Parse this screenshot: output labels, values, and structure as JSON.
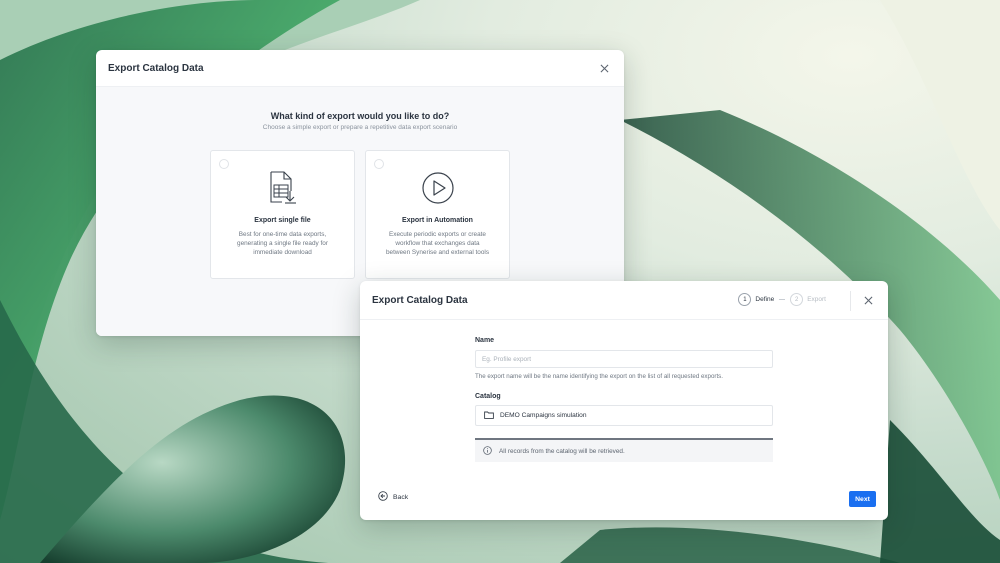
{
  "export_type_modal": {
    "title": "Export Catalog Data",
    "question": "What kind of export would you like to do?",
    "subtitle": "Choose a simple export or prepare a repetitive data export scenario",
    "options": [
      {
        "title": "Export single file",
        "description": "Best for one-time data exports, generating a single file ready for immediate download",
        "icon": "file-table-icon"
      },
      {
        "title": "Export in Automation",
        "description": "Execute periodic exports or create workflow that exchanges data between Synerise and external tools",
        "icon": "play-circle-icon"
      }
    ]
  },
  "export_form_modal": {
    "title": "Export Catalog Data",
    "steps": [
      {
        "number": "1",
        "label": "Define",
        "active": true
      },
      {
        "number": "2",
        "label": "Export",
        "active": false
      }
    ],
    "name_label": "Name",
    "name_placeholder": "Eg. Profile export",
    "name_hint": "The export name will be the name identifying the export on the list of all requested exports.",
    "catalog_label": "Catalog",
    "catalog_value": "DEMO Campaigns simulation",
    "info_text": "All records from the catalog will be retrieved.",
    "back_label": "Back",
    "next_label": "Next"
  },
  "colors": {
    "primary": "#1a6ff0",
    "text": "#2b3440",
    "muted": "#6f7883"
  }
}
